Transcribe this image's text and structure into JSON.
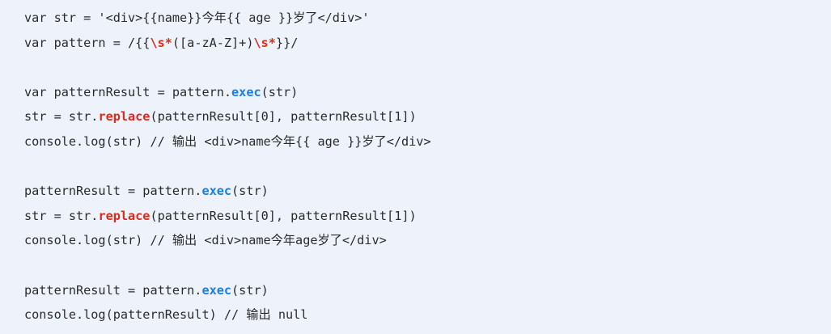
{
  "colors": {
    "background": "#edf2fb",
    "text": "#2b2b2b",
    "keyword_red": "#e0281b",
    "keyword_blue": "#1a7fe0"
  },
  "code": {
    "lines": [
      {
        "tokens": [
          {
            "t": "var str = '<div>{{name}}今年{{ age }}岁了</div>'",
            "k": "plain"
          }
        ]
      },
      {
        "tokens": [
          {
            "t": "var pattern = /{{",
            "k": "plain"
          },
          {
            "t": "\\s*",
            "k": "red"
          },
          {
            "t": "([a-zA-Z]+)",
            "k": "plain"
          },
          {
            "t": "\\s*",
            "k": "red"
          },
          {
            "t": "}}/",
            "k": "plain"
          }
        ]
      },
      {
        "tokens": []
      },
      {
        "tokens": [
          {
            "t": "var patternResult = pattern.",
            "k": "plain"
          },
          {
            "t": "exec",
            "k": "blue"
          },
          {
            "t": "(str)",
            "k": "plain"
          }
        ]
      },
      {
        "tokens": [
          {
            "t": "str = str.",
            "k": "plain"
          },
          {
            "t": "replace",
            "k": "red"
          },
          {
            "t": "(patternResult[0], patternResult[1])",
            "k": "plain"
          }
        ]
      },
      {
        "tokens": [
          {
            "t": "console.log(str) // 输出 <div>name今年{{ age }}岁了</div>",
            "k": "plain"
          }
        ]
      },
      {
        "tokens": []
      },
      {
        "tokens": [
          {
            "t": "patternResult = pattern.",
            "k": "plain"
          },
          {
            "t": "exec",
            "k": "blue"
          },
          {
            "t": "(str)",
            "k": "plain"
          }
        ]
      },
      {
        "tokens": [
          {
            "t": "str = str.",
            "k": "plain"
          },
          {
            "t": "replace",
            "k": "red"
          },
          {
            "t": "(patternResult[0], patternResult[1])",
            "k": "plain"
          }
        ]
      },
      {
        "tokens": [
          {
            "t": "console.log(str) // 输出 <div>name今年age岁了</div>",
            "k": "plain"
          }
        ]
      },
      {
        "tokens": []
      },
      {
        "tokens": [
          {
            "t": "patternResult = pattern.",
            "k": "plain"
          },
          {
            "t": "exec",
            "k": "blue"
          },
          {
            "t": "(str)",
            "k": "plain"
          }
        ]
      },
      {
        "tokens": [
          {
            "t": "console.log(patternResult) // 输出 null",
            "k": "plain"
          }
        ]
      }
    ]
  }
}
